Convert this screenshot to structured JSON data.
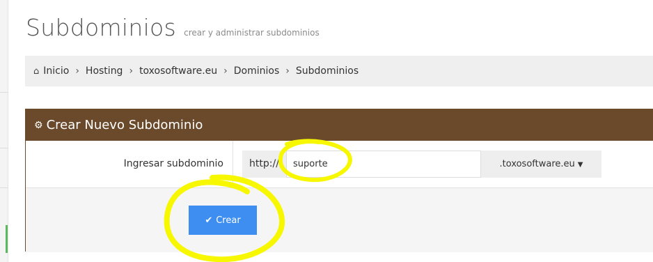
{
  "header": {
    "title": "Subdominios",
    "subtitle": "crear y administrar subdominios"
  },
  "breadcrumb": {
    "home_icon": "home-icon",
    "items": [
      "Inicio",
      "Hosting",
      "toxosoftware.eu",
      "Dominios",
      "Subdominios"
    ],
    "separator": "›"
  },
  "panel": {
    "title": "Crear Nuevo Subdominio",
    "title_icon": "cogs-icon",
    "header_color": "#6b4a2b",
    "field_label": "Ingresar subdominio",
    "prefix": "http://",
    "subdomain_value": "suporte",
    "domain_suffix": ".toxosoftware.eu",
    "submit_label": "Crear",
    "submit_icon": "check-icon",
    "submit_color": "#3d8ef0"
  },
  "annotation": {
    "color": "#f7f700"
  }
}
